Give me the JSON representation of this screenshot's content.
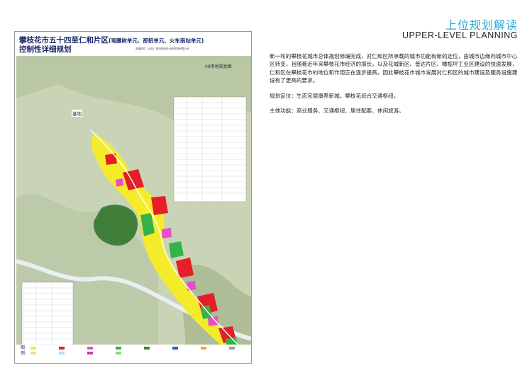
{
  "header": {
    "title_cn": "上位规划解读",
    "title_en": "UPPER-LEVEL PLANNING"
  },
  "content": {
    "paragraph_1": "新一轮的攀枝花城市总体规划修编完成，对仁和区所承载的城市功能有新的定位，由城市边缘向城市中心区转变，且随着近年来攀枝花市经济的增长，以及花城新区、普达片区、橄榄坪工业区建设的快速发展，仁和区在攀枝花市的地位和作用正在逐步提高，因此攀枝花市城市发展对仁和区的城市建设及服务设施建设有了更高的要求。",
    "paragraph_2": "规划定位：生态宜居康养新城，攀枝花综合交通枢纽。",
    "paragraph_3": "主体功能：商业服务、交通枢纽、居住配套、休闲旅游。"
  },
  "board": {
    "title_line1": "攀枝花市五十四至仁和片区",
    "title_line1_sub": "(弯腰树单元、那招单元、火车南站单元)",
    "title_line2": "控制性详细规划",
    "credit": "若事机位（北京）城市规划设计研究院有限公司",
    "map_label": "08用地规划图",
    "site_label": "基地",
    "legend_label": "图例"
  },
  "colors": {
    "accent": "#29a9d6",
    "title_navy": "#1a2a6c",
    "residential": "#f4ec2a",
    "commercial": "#e61e28",
    "public": "#e64fc8",
    "green": "#34b34a",
    "forest": "#3f7f3a",
    "road": "#f2f2f2"
  }
}
